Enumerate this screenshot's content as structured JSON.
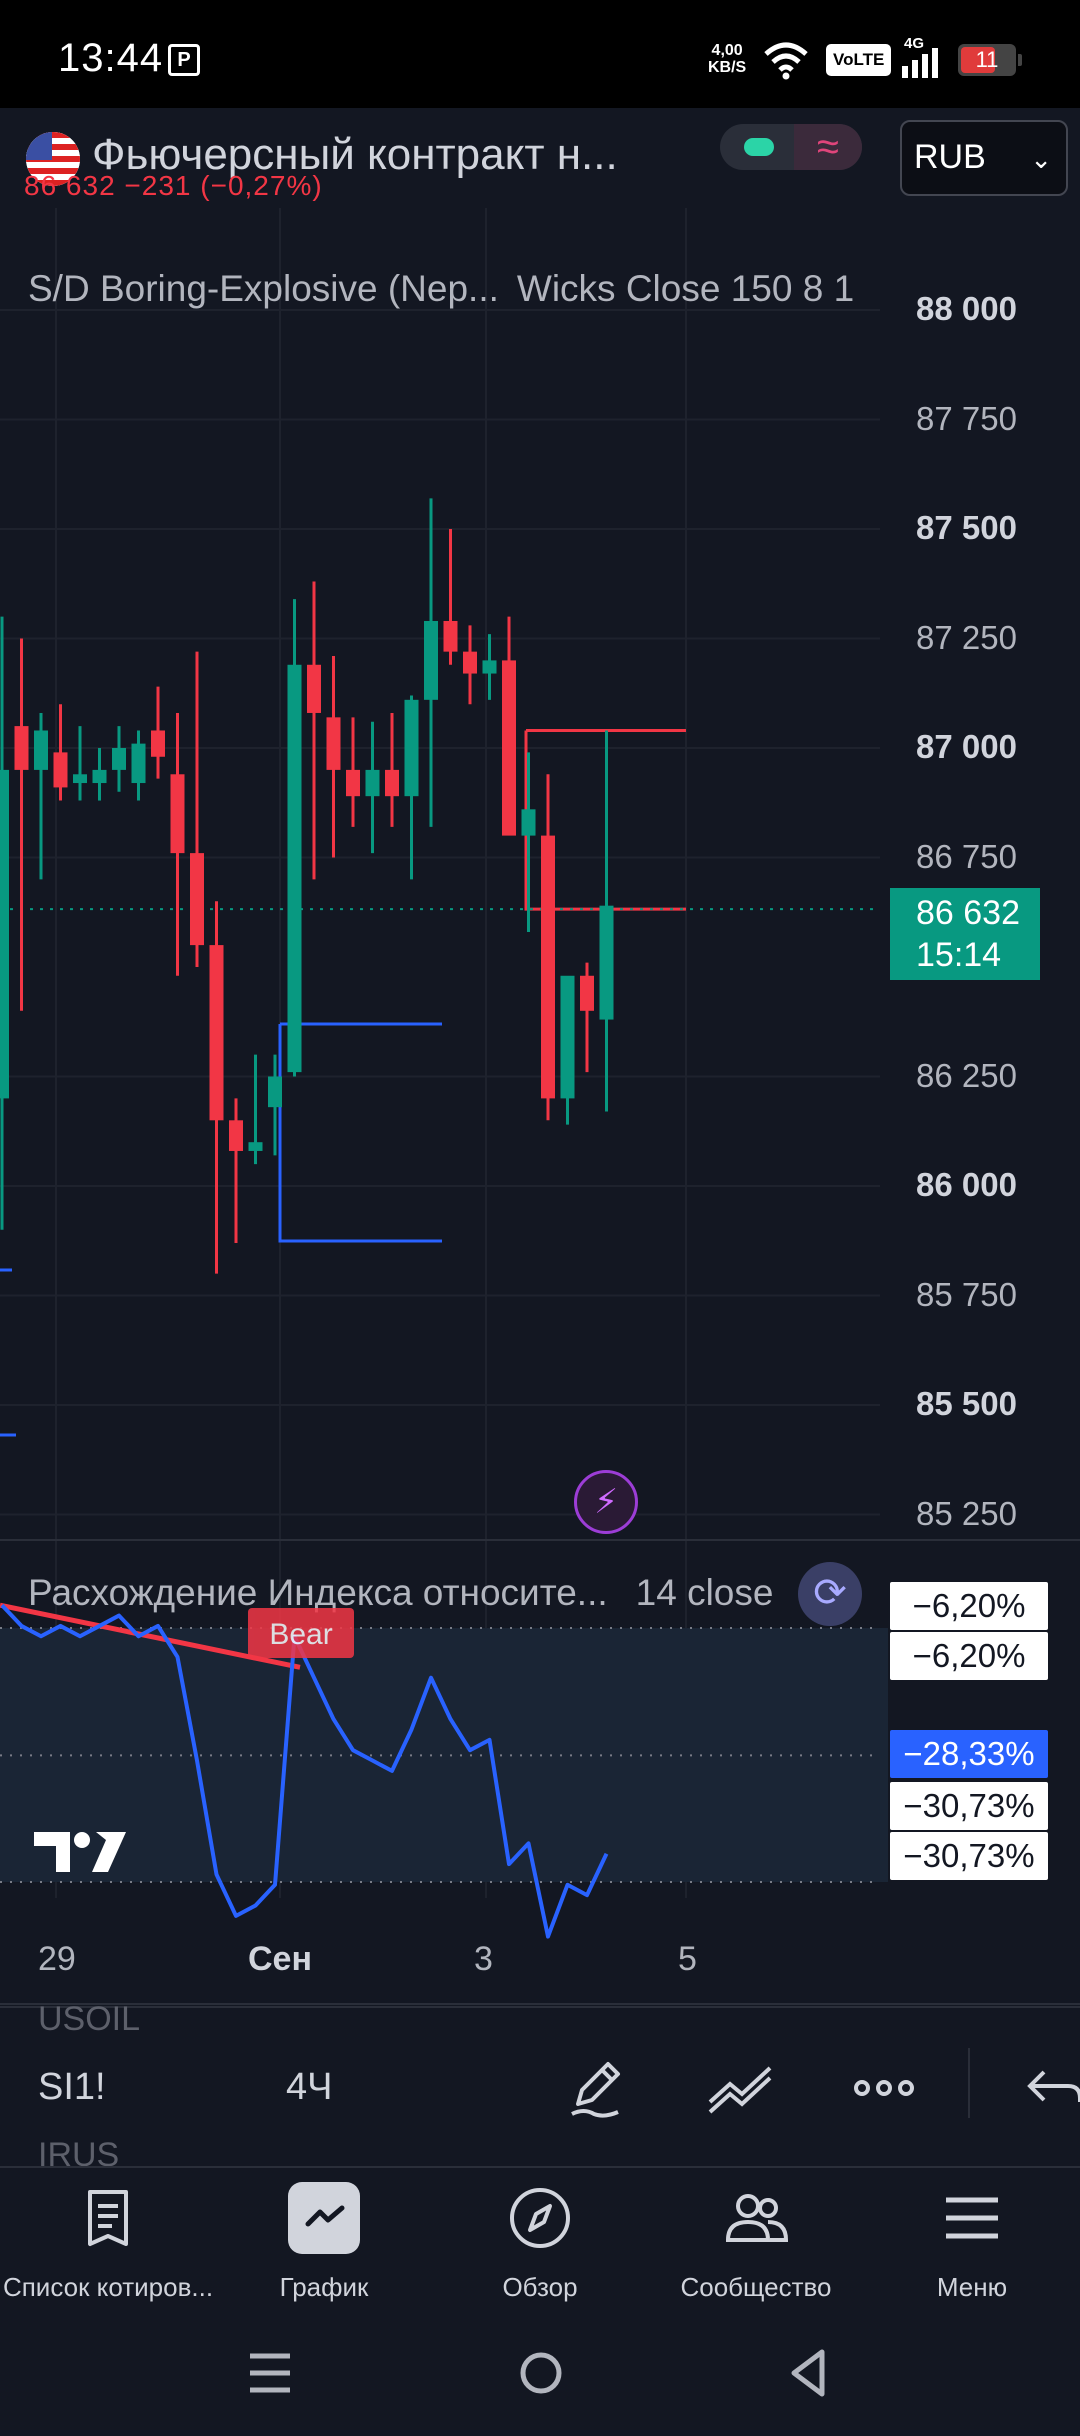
{
  "status_bar": {
    "time": "13:44",
    "p_icon": "P",
    "net_speed_value": "4,00",
    "net_speed_unit": "KB/S",
    "volte": "VoLTE",
    "network": "4G",
    "battery": "11"
  },
  "header": {
    "symbol_title": "Фьючерсный контракт н...",
    "price_change": "86 632  −231 (−0,27%)",
    "currency": "RUB",
    "flag_icon": "us-flag-icon"
  },
  "main_chart": {
    "indicator_name": "S/D Boring-Explosive (Nep...",
    "indicator_params": "Wicks Close 150 8 1",
    "price_axis": [
      {
        "label": "88 000",
        "bold": true
      },
      {
        "label": "87 750",
        "bold": false
      },
      {
        "label": "87 500",
        "bold": true
      },
      {
        "label": "87 250",
        "bold": false
      },
      {
        "label": "87 000",
        "bold": true
      },
      {
        "label": "86 750",
        "bold": false
      },
      {
        "label": "86 250",
        "bold": false
      },
      {
        "label": "86 000",
        "bold": true
      },
      {
        "label": "85 750",
        "bold": false
      },
      {
        "label": "85 500",
        "bold": true
      },
      {
        "label": "85 250",
        "bold": false
      }
    ],
    "current_price": "86 632",
    "countdown": "15:14",
    "colors": {
      "up": "#089981",
      "down": "#f23645",
      "zone": "#2962ff",
      "background": "#131722"
    }
  },
  "oscillator": {
    "name": "Расхождение Индекса относите...",
    "params": "14 close",
    "bear_label": "Bear",
    "tags": [
      {
        "label": "−6,20%",
        "style": "white"
      },
      {
        "label": "−6,20%",
        "style": "white"
      },
      {
        "label": "−28,33%",
        "style": "blue"
      },
      {
        "label": "−30,73%",
        "style": "white"
      },
      {
        "label": "−30,73%",
        "style": "white"
      }
    ]
  },
  "time_axis": [
    {
      "label": "29",
      "bold": false
    },
    {
      "label": "Сен",
      "bold": true
    },
    {
      "label": "3",
      "bold": false
    },
    {
      "label": "5",
      "bold": false
    }
  ],
  "toolbar": {
    "ghost_above": "USOIL",
    "ticker": "SI1!",
    "ghost_below": "IRUS",
    "timeframe": "4Ч",
    "icons": [
      "pen-icon",
      "trend-lines-icon",
      "more-icon",
      "undo-icon"
    ]
  },
  "bottom_nav": [
    {
      "label": "Список котиров...",
      "icon": "watchlist-icon",
      "active": false
    },
    {
      "label": "График",
      "icon": "chart-icon",
      "active": true
    },
    {
      "label": "Обзор",
      "icon": "compass-icon",
      "active": false
    },
    {
      "label": "Сообщество",
      "icon": "community-icon",
      "active": false
    },
    {
      "label": "Меню",
      "icon": "menu-icon",
      "active": false
    }
  ],
  "chart_data": {
    "type": "candlestick",
    "timeframe": "4Ч",
    "x_ticks": [
      "29",
      "Сен",
      "3",
      "5"
    ],
    "y_ticks": [
      88000,
      87750,
      87500,
      87250,
      87000,
      86750,
      86250,
      86000,
      85750,
      85500,
      85250
    ],
    "ylim": [
      85220,
      88120
    ],
    "last_price": 86632,
    "candles": [
      {
        "o": 86200,
        "h": 87300,
        "l": 85900,
        "c": 86950
      },
      {
        "o": 87050,
        "h": 87250,
        "l": 86400,
        "c": 86950
      },
      {
        "o": 86950,
        "h": 87080,
        "l": 86700,
        "c": 87040
      },
      {
        "o": 86990,
        "h": 87100,
        "l": 86880,
        "c": 86910
      },
      {
        "o": 86920,
        "h": 87050,
        "l": 86880,
        "c": 86940
      },
      {
        "o": 86920,
        "h": 87000,
        "l": 86880,
        "c": 86950
      },
      {
        "o": 86950,
        "h": 87050,
        "l": 86900,
        "c": 87000
      },
      {
        "o": 86920,
        "h": 87040,
        "l": 86880,
        "c": 87010
      },
      {
        "o": 87040,
        "h": 87140,
        "l": 86930,
        "c": 86980
      },
      {
        "o": 86940,
        "h": 87080,
        "l": 86480,
        "c": 86760
      },
      {
        "o": 86760,
        "h": 87220,
        "l": 86500,
        "c": 86550
      },
      {
        "o": 86550,
        "h": 86650,
        "l": 85800,
        "c": 86150
      },
      {
        "o": 86150,
        "h": 86200,
        "l": 85870,
        "c": 86080
      },
      {
        "o": 86080,
        "h": 86300,
        "l": 86050,
        "c": 86100
      },
      {
        "o": 86180,
        "h": 86300,
        "l": 86070,
        "c": 86250
      },
      {
        "o": 86260,
        "h": 87340,
        "l": 86250,
        "c": 87190
      },
      {
        "o": 87190,
        "h": 87380,
        "l": 86700,
        "c": 87080
      },
      {
        "o": 87070,
        "h": 87210,
        "l": 86750,
        "c": 86950
      },
      {
        "o": 86950,
        "h": 87070,
        "l": 86820,
        "c": 86890
      },
      {
        "o": 86890,
        "h": 87060,
        "l": 86760,
        "c": 86950
      },
      {
        "o": 86950,
        "h": 87080,
        "l": 86820,
        "c": 86890
      },
      {
        "o": 86890,
        "h": 87120,
        "l": 86700,
        "c": 87110
      },
      {
        "o": 87110,
        "h": 87570,
        "l": 86820,
        "c": 87290
      },
      {
        "o": 87290,
        "h": 87500,
        "l": 87190,
        "c": 87220
      },
      {
        "o": 87220,
        "h": 87280,
        "l": 87100,
        "c": 87170
      },
      {
        "o": 87170,
        "h": 87260,
        "l": 87110,
        "c": 87200
      },
      {
        "o": 87200,
        "h": 87300,
        "l": 86930,
        "c": 86800
      },
      {
        "o": 86800,
        "h": 86990,
        "l": 86580,
        "c": 86860
      },
      {
        "o": 86800,
        "h": 86940,
        "l": 86150,
        "c": 86200
      },
      {
        "o": 86200,
        "h": 86460,
        "l": 86140,
        "c": 86480
      },
      {
        "o": 86480,
        "h": 86510,
        "l": 86260,
        "c": 86400
      },
      {
        "o": 86380,
        "h": 87040,
        "l": 86170,
        "c": 86640
      }
    ],
    "oscillator": {
      "name": "Расхождение Индекса относите...",
      "values": [
        -4,
        -6,
        -7,
        -6,
        -7,
        -6,
        -5,
        -7,
        -6,
        -9,
        -19,
        -30,
        -34,
        -33,
        -31,
        -7,
        -11,
        -15,
        -18,
        -19,
        -20,
        -16,
        -11,
        -15,
        -18,
        -17,
        -29,
        -27,
        -36,
        -31,
        -32,
        -28
      ],
      "last_value": -28.33,
      "levels": [
        -6.2,
        -30.73
      ],
      "divergence_label": "Bear"
    }
  }
}
